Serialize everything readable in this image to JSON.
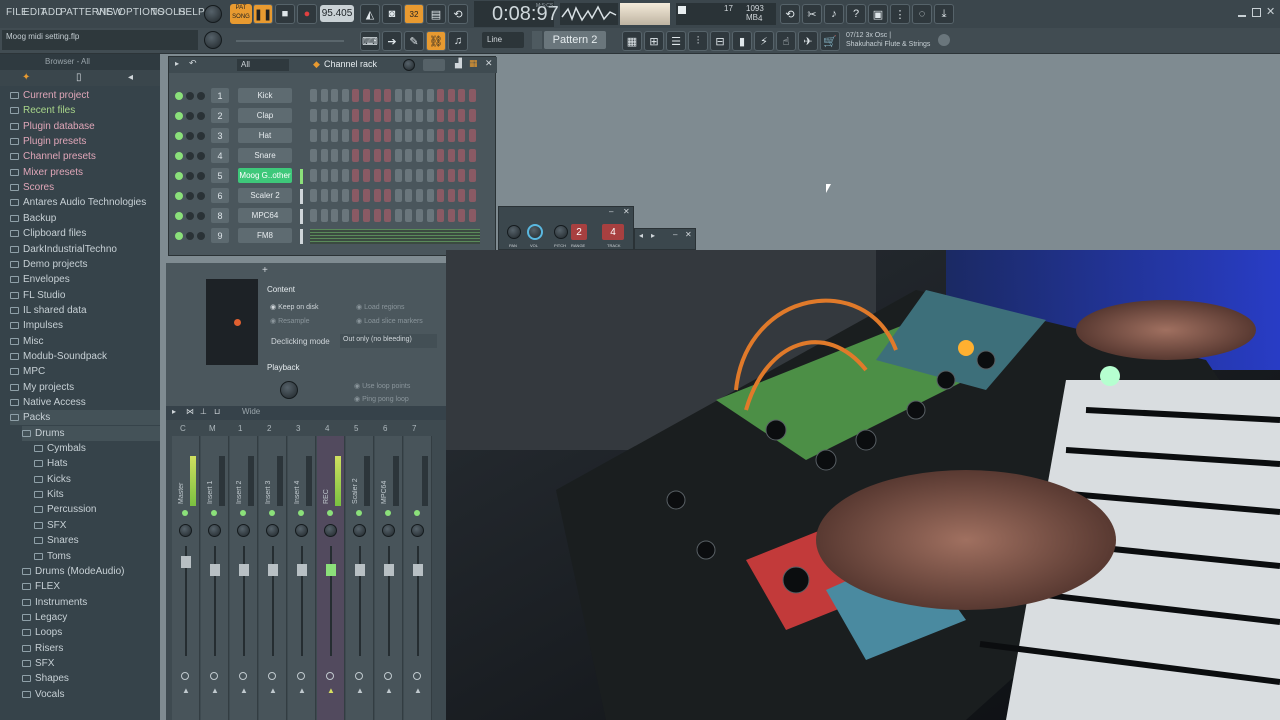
{
  "menu": [
    "FILE",
    "EDIT",
    "ADD",
    "PATTERNS",
    "VIEW",
    "OPTIONS",
    "TOOLS",
    "HELP"
  ],
  "transport": {
    "pat_label": "PAT",
    "song_label": "SONG",
    "tempo": "95.405",
    "time": "0:08:97",
    "time_unit": "M:S:CS",
    "beats": "32"
  },
  "meters": {
    "cpu": "17",
    "memory": "1093 MB",
    "polyphony": "4"
  },
  "hint_bar": {
    "text": "Moog midi setting.flp"
  },
  "toolbar2": {
    "snap": "Line",
    "pattern": "Pattern 2",
    "plugin_hint_line1": "07/12  3x Osc |",
    "plugin_hint_line2": "Shakuhachi Flute & Strings"
  },
  "browser": {
    "header": "Browser - All",
    "items": [
      {
        "label": "Current project",
        "style": "pink"
      },
      {
        "label": "Recent files",
        "style": "green"
      },
      {
        "label": "Plugin database",
        "style": "pink"
      },
      {
        "label": "Plugin presets",
        "style": "pink"
      },
      {
        "label": "Channel presets",
        "style": "pink"
      },
      {
        "label": "Mixer presets",
        "style": "pink"
      },
      {
        "label": "Scores",
        "style": "pink"
      },
      {
        "label": "Antares Audio Technologies",
        "style": "plain"
      },
      {
        "label": "Backup",
        "style": "plain"
      },
      {
        "label": "Clipboard files",
        "style": "plain"
      },
      {
        "label": "DarkIndustrialTechno",
        "style": "plain"
      },
      {
        "label": "Demo projects",
        "style": "plain"
      },
      {
        "label": "Envelopes",
        "style": "plain"
      },
      {
        "label": "FL Studio",
        "style": "plain"
      },
      {
        "label": "IL shared data",
        "style": "plain"
      },
      {
        "label": "Impulses",
        "style": "plain"
      },
      {
        "label": "Misc",
        "style": "plain"
      },
      {
        "label": "Modub-Soundpack",
        "style": "plain"
      },
      {
        "label": "MPC",
        "style": "plain"
      },
      {
        "label": "My projects",
        "style": "plain"
      },
      {
        "label": "Native Access",
        "style": "plain"
      },
      {
        "label": "Packs",
        "style": "open"
      },
      {
        "label": "Drums",
        "style": "open1"
      },
      {
        "label": "Cymbals",
        "style": "sub"
      },
      {
        "label": "Hats",
        "style": "sub"
      },
      {
        "label": "Kicks",
        "style": "sub"
      },
      {
        "label": "Kits",
        "style": "sub"
      },
      {
        "label": "Percussion",
        "style": "sub"
      },
      {
        "label": "SFX",
        "style": "sub"
      },
      {
        "label": "Snares",
        "style": "sub"
      },
      {
        "label": "Toms",
        "style": "sub"
      },
      {
        "label": "Drums (ModeAudio)",
        "style": "lvl1"
      },
      {
        "label": "FLEX",
        "style": "lvl1"
      },
      {
        "label": "Instruments",
        "style": "lvl1"
      },
      {
        "label": "Legacy",
        "style": "lvl1"
      },
      {
        "label": "Loops",
        "style": "lvl1"
      },
      {
        "label": "Risers",
        "style": "lvl1"
      },
      {
        "label": "SFX",
        "style": "lvl1"
      },
      {
        "label": "Shapes",
        "style": "lvl1"
      },
      {
        "label": "Vocals",
        "style": "lvl1"
      }
    ]
  },
  "channel_rack": {
    "title": "Channel rack",
    "filter": "All",
    "channels": [
      {
        "num": "1",
        "name": "Kick"
      },
      {
        "num": "2",
        "name": "Clap"
      },
      {
        "num": "3",
        "name": "Hat"
      },
      {
        "num": "4",
        "name": "Snare"
      },
      {
        "num": "5",
        "name": "Moog G..other"
      },
      {
        "num": "6",
        "name": "Scaler 2"
      },
      {
        "num": "8",
        "name": "MPC64"
      },
      {
        "num": "9",
        "name": "FM8"
      }
    ]
  },
  "sampler": {
    "content_label": "Content",
    "keep_on_disk": "Keep on disk",
    "resample": "Resample",
    "load_regions": "Load regions",
    "load_slice_markers": "Load slice markers",
    "declicking_label": "Declicking mode",
    "declicking_value": "Out only (no bleeding)",
    "playback_label": "Playback",
    "use_loop_points": "Use loop points",
    "ping_pong_loop": "Ping pong loop"
  },
  "mini_channel": {
    "labels": [
      "PAN",
      "VOL",
      "PITCH",
      "RANGE",
      "TRACK"
    ],
    "range": "2",
    "track": "4"
  },
  "mixer": {
    "preset": "Wide",
    "header": [
      "C",
      "M",
      "1",
      "2",
      "3",
      "4",
      "5",
      "6",
      "7"
    ],
    "strips": [
      "Master",
      "Insert 1",
      "Insert 2",
      "Insert 3",
      "Insert 4",
      "REC",
      "Scaler 2",
      "MPC64",
      ""
    ]
  },
  "colors": {
    "accent_green": "#8be07a",
    "led": "#f0a030",
    "record": "#e04040"
  }
}
